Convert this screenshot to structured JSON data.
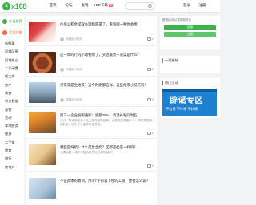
{
  "header": {
    "logo_text": "x108",
    "logo_badge": "x",
    "nav": [
      "首页",
      "论坛",
      "发现",
      "APP下载"
    ],
    "app_badge": "新",
    "login": "登录",
    "register": "注册"
  },
  "sidebar": {
    "tabs": [
      {
        "label": "今日推荐"
      },
      {
        "label": "大家在聊"
      }
    ],
    "links": [
      "新鲜事",
      "阿城区圈",
      "阿城热议",
      "二手闲置",
      "找工作",
      "房产",
      "美食",
      "带点数据",
      "宠物",
      "活动",
      "本地服务",
      "健身",
      "二手车",
      "教育",
      "旅行",
      "房地产"
    ]
  },
  "feed": [
    {
      "title": "住房公积金提取办理指南来了，看看哪一种你会用",
      "desc": "",
      "author": "阿城区小助手",
      "comments": "0"
    },
    {
      "title": "这一周的行内小动物到了，买过最贵一道菜是什么？",
      "desc": "",
      "author": "阿城区小助手",
      "comments": "0"
    },
    {
      "title": "打车或是坐地铁？这个时期都这样，这些你来小技巧吗？",
      "desc": "",
      "author": "阿城区小助手",
      "comments": "0"
    },
    {
      "title": "阿三一企业发明通知：底薪25%，高温补贴同时在",
      "desc": "近日，阿城区某中小企业发布招聘启事，月薪底薪提高25%，同时享受高温补贴，吸引了大量求职者关注。",
      "author": "阿城区小助手",
      "comments": "0"
    },
    {
      "title": "哪些是纯奶？什么是复合奶？区都百奶是一样的？",
      "desc": "上周话题：纯奶与复合奶的区别你知道吗？",
      "author": "阿城区小助手",
      "comments": "0"
    },
    {
      "title": "不该具体的教训，用4个字形容下你的工资，你会怎么说？",
      "desc": "",
      "author": "阿城区小助手",
      "comments": "0"
    }
  ],
  "right": {
    "login_tip": "登录后可以发帖和评论",
    "login_btn": "登录",
    "register_btn": "注册",
    "quote_title": "一周热帖",
    "hot_title": "热门活动",
    "ad_main": "辟谣专区",
    "ad_sub": "不信谣 不传谣 不转谣"
  },
  "colors": {
    "accent": "#3bb34a",
    "hot": "#ff6a3d",
    "ad_blue": "#1f7fd1"
  }
}
